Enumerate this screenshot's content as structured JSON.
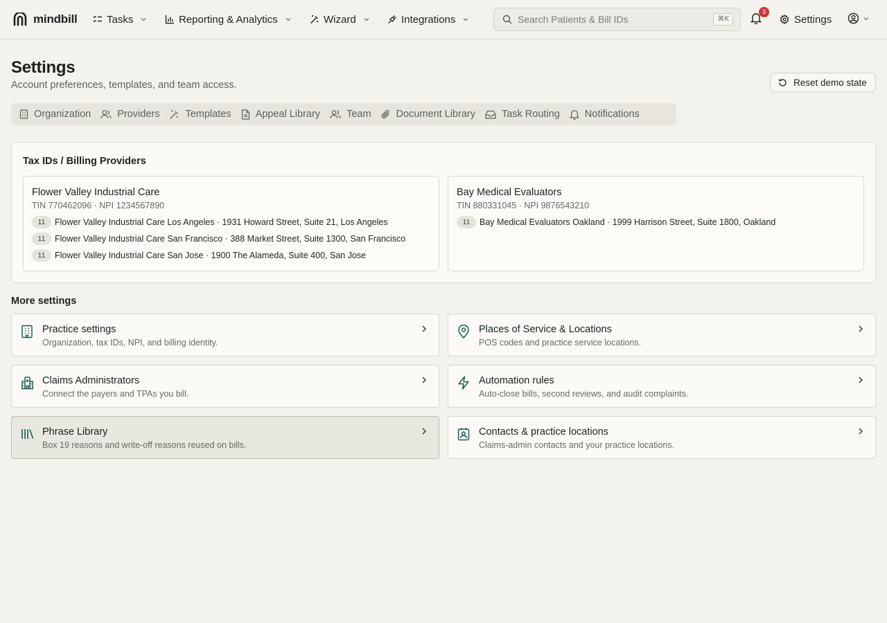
{
  "brand": {
    "name": "mindbill"
  },
  "nav": {
    "items": [
      {
        "label": "Tasks",
        "icon": "list-check-icon"
      },
      {
        "label": "Reporting & Analytics",
        "icon": "bar-chart-icon"
      },
      {
        "label": "Wizard",
        "icon": "magic-wand-icon"
      },
      {
        "label": "Integrations",
        "icon": "plug-icon"
      }
    ],
    "search_placeholder": "Search Patients & Bill IDs",
    "search_shortcut": "⌘K",
    "notification_count": "3",
    "settings_label": "Settings"
  },
  "header": {
    "title": "Settings",
    "subtitle": "Account preferences, templates, and team access.",
    "reset_label": "Reset demo state"
  },
  "tabs": [
    {
      "label": "Organization",
      "icon": "building-icon"
    },
    {
      "label": "Providers",
      "icon": "users-icon"
    },
    {
      "label": "Templates",
      "icon": "magic-wand-icon"
    },
    {
      "label": "Appeal Library",
      "icon": "file-text-icon"
    },
    {
      "label": "Team",
      "icon": "users-icon"
    },
    {
      "label": "Document Library",
      "icon": "paperclip-icon"
    },
    {
      "label": "Task Routing",
      "icon": "inbox-icon"
    },
    {
      "label": "Notifications",
      "icon": "bell-icon"
    }
  ],
  "tax_ids": {
    "title": "Tax IDs / Billing Providers",
    "providers": [
      {
        "name": "Flower Valley Industrial Care",
        "ids": "TIN 770462096 · NPI 1234567890",
        "locations": [
          {
            "pos": "11",
            "text": "Flower Valley Industrial Care Los Angeles · 1931 Howard Street, Suite 21, Los Angeles"
          },
          {
            "pos": "11",
            "text": "Flower Valley Industrial Care San Francisco · 388 Market Street, Suite 1300, San Francisco"
          },
          {
            "pos": "11",
            "text": "Flower Valley Industrial Care San Jose · 1900 The Alameda, Suite 400, San Jose"
          }
        ]
      },
      {
        "name": "Bay Medical Evaluators",
        "ids": "TIN 880331045 · NPI 9876543210",
        "locations": [
          {
            "pos": "11",
            "text": "Bay Medical Evaluators Oakland · 1999 Harrison Street, Suite 1800, Oakland"
          }
        ]
      }
    ]
  },
  "more_settings": {
    "title": "More settings",
    "tiles": [
      {
        "title": "Practice settings",
        "desc": "Organization, tax IDs, NPI, and billing identity.",
        "icon": "building-icon"
      },
      {
        "title": "Places of Service & Locations",
        "desc": "POS codes and practice service locations.",
        "icon": "map-pin-icon"
      },
      {
        "title": "Claims Administrators",
        "desc": "Connect the payers and TPAs you bill.",
        "icon": "hospital-icon"
      },
      {
        "title": "Automation rules",
        "desc": "Auto-close bills, second reviews, and audit complaints.",
        "icon": "lightning-icon"
      },
      {
        "title": "Phrase Library",
        "desc": "Box 19 reasons and write-off reasons reused on bills.",
        "icon": "library-icon"
      },
      {
        "title": "Contacts & practice locations",
        "desc": "Claims-admin contacts and your practice locations.",
        "icon": "contact-icon"
      }
    ]
  },
  "colors": {
    "accent_icon": "#1f5c57",
    "badge": "#d0343c",
    "background": "#f4f2ec"
  }
}
